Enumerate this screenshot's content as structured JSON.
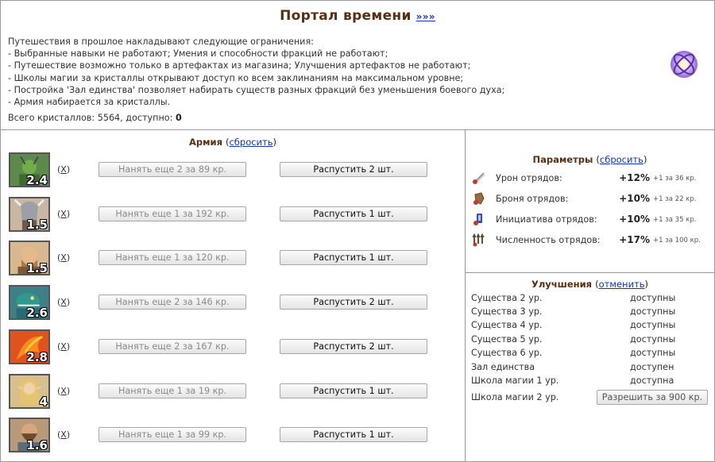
{
  "header": {
    "title": "Портал времени",
    "more_link": "»»»"
  },
  "info": {
    "lines": [
      "Путешествия в прошлое накладывают следующие ограничения:",
      "- Выбранные навыки не работают; Умения и способности фракций не работают;",
      "- Путешествие возможно только в артефактах из магазина; Улучшения артефактов не работают;",
      "- Школы магии за кристаллы открывают доступ ко всем заклинаниям на максимальном уровне;",
      "- Постройка 'Зал единства' позволяет набирать существ разных фракций без уменьшения боевого духа;",
      "- Армия набирается за кристаллы."
    ],
    "crystals_label": "Всего кристаллов: 5564, доступно:",
    "crystals_available": "0"
  },
  "army": {
    "title": "Армия",
    "paren_open": "(",
    "reset_link": "сбросить",
    "paren_close": ")",
    "units": [
      {
        "level": "2.4",
        "remove": "X",
        "hire": "Нанять еще 2 за 89 кр.",
        "dismiss": "Распустить 2 шт.",
        "portrait": "green-orc-warrior",
        "bg": "#5d8a4a"
      },
      {
        "level": "1.5",
        "remove": "X",
        "hire": "Нанять еще 1 за 192 кр.",
        "dismiss": "Распустить 1 шт.",
        "portrait": "horned-helmet-knight",
        "bg": "#c9b7a2"
      },
      {
        "level": "1.5",
        "remove": "X",
        "hire": "Нанять еще 1 за 120 кр.",
        "dismiss": "Распустить 1 шт.",
        "portrait": "bald-dwarf",
        "bg": "#d8b98f"
      },
      {
        "level": "2.6",
        "remove": "X",
        "hire": "Нанять еще 2 за 146 кр.",
        "dismiss": "Распустить 2 шт.",
        "portrait": "teal-lizard",
        "bg": "#3f7f86"
      },
      {
        "level": "2.8",
        "remove": "X",
        "hire": "Нанять еще 2 за 167 кр.",
        "dismiss": "Распустить 2 шт.",
        "portrait": "phoenix-bird",
        "bg": "#e0521e"
      },
      {
        "level": "4",
        "remove": "X",
        "hire": "Нанять еще 1 за 19 кр.",
        "dismiss": "Распустить 1 шт.",
        "portrait": "elf-woman",
        "bg": "#d7c08c"
      },
      {
        "level": "1.6",
        "remove": "X",
        "hire": "Нанять еще 1 за 99 кр.",
        "dismiss": "Распустить 1 шт.",
        "portrait": "bearded-man",
        "bg": "#b89a7a"
      }
    ]
  },
  "params": {
    "title": "Параметры",
    "paren_open": "(",
    "reset_link": "сбросить",
    "paren_close": ")",
    "rows": [
      {
        "icon": "sword-damage-icon",
        "label": "Урон отрядов:",
        "value": "+12%",
        "cost": "+1 за 36 кр."
      },
      {
        "icon": "armor-icon",
        "label": "Броня отрядов:",
        "value": "+10%",
        "cost": "+1 за 22 кр."
      },
      {
        "icon": "initiative-icon",
        "label": "Инициатива отрядов:",
        "value": "+10%",
        "cost": "+1 за 35 кр."
      },
      {
        "icon": "troops-count-icon",
        "label": "Численность отрядов:",
        "value": "+17%",
        "cost": "+1 за 100 кр."
      }
    ]
  },
  "upgrades": {
    "title": "Улучшения",
    "paren_open": "(",
    "cancel_link": "отменить",
    "paren_close": ")",
    "rows": [
      {
        "name": "Существа 2 ур.",
        "status": "доступны"
      },
      {
        "name": "Существа 3 ур.",
        "status": "доступны"
      },
      {
        "name": "Существа 4 ур.",
        "status": "доступны"
      },
      {
        "name": "Существа 5 ур.",
        "status": "доступны"
      },
      {
        "name": "Существа 6 ур.",
        "status": "доступны"
      },
      {
        "name": "Зал единства",
        "status": "доступен"
      },
      {
        "name": "Школа магии 1 ур.",
        "status": "доступна"
      }
    ],
    "magic2": {
      "name": "Школа магии 2 ур.",
      "button": "Разрешить за 900 кр."
    }
  },
  "colors": {
    "title_brown": "#5a2e10",
    "link_blue": "#1133cc",
    "border_gray": "#9a9a9a"
  }
}
